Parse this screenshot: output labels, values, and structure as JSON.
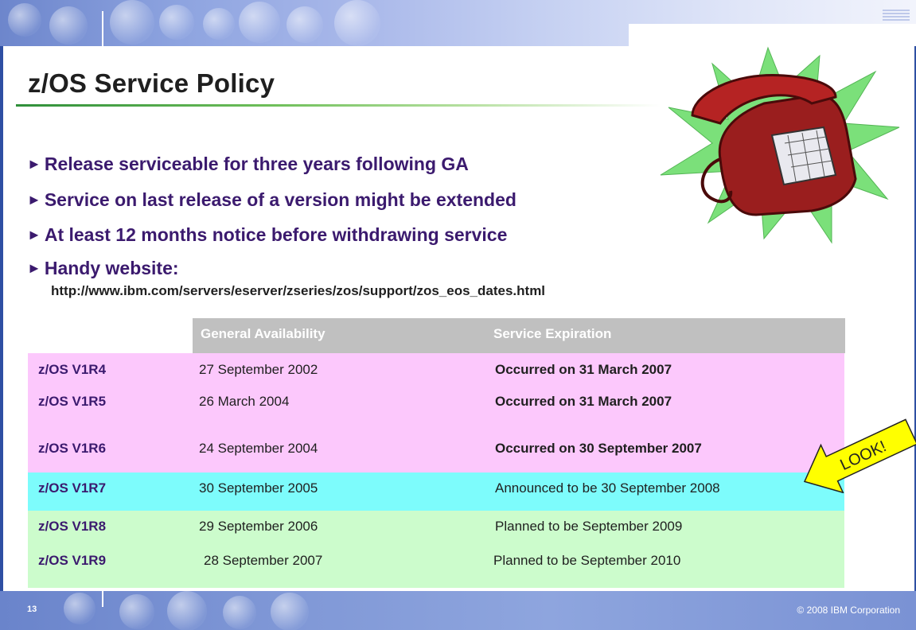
{
  "slide": {
    "title": "z/OS Service Policy",
    "page_number": "13",
    "copyright": "© 2008 IBM Corporation"
  },
  "bullets": [
    "Release serviceable for three years following GA",
    "Service on last release of a version might be extended",
    "At least 12 months notice before withdrawing service",
    "Handy website:"
  ],
  "website_url": "http://www.ibm.com/servers/eserver/zseries/zos/support/zos_eos_dates.html",
  "table": {
    "headers": [
      "General Availability",
      "Service Expiration"
    ],
    "rows": [
      {
        "release": "z/OS V1R4",
        "ga": "27 September 2002",
        "expiration": "Occurred on 31 March 2007",
        "status": "expired"
      },
      {
        "release": "z/OS V1R5",
        "ga": "26 March 2004",
        "expiration": "Occurred on 31 March 2007",
        "status": "expired"
      },
      {
        "release": "z/OS V1R6",
        "ga": "24 September 2004",
        "expiration": "Occurred on 30 September 2007",
        "status": "expired"
      },
      {
        "release": "z/OS V1R7",
        "ga": "30 September 2005",
        "expiration": "Announced to be 30 September 2008",
        "status": "announced"
      },
      {
        "release": "z/OS V1R8",
        "ga": "29 September 2006",
        "expiration": "Planned to be September 2009",
        "status": "planned"
      },
      {
        "release": "z/OS V1R9",
        "ga": "28 September 2007",
        "expiration": "Planned to be September 2010",
        "status": "planned"
      }
    ]
  },
  "callout": {
    "text": "LOOK!"
  },
  "colors": {
    "expired_row": "#fcc8fc",
    "announced_row": "#7dfcfc",
    "planned_row": "#ccfccc",
    "header_row": "#c0c0c0",
    "bullet_text": "#3b1a6e",
    "banner_blue": "#6d86cc",
    "callout_yellow": "#ffff00"
  },
  "icons": {
    "bullet": "triangle-right-icon",
    "phone": "ringing-telephone-icon",
    "callout": "arrow-left-icon"
  }
}
